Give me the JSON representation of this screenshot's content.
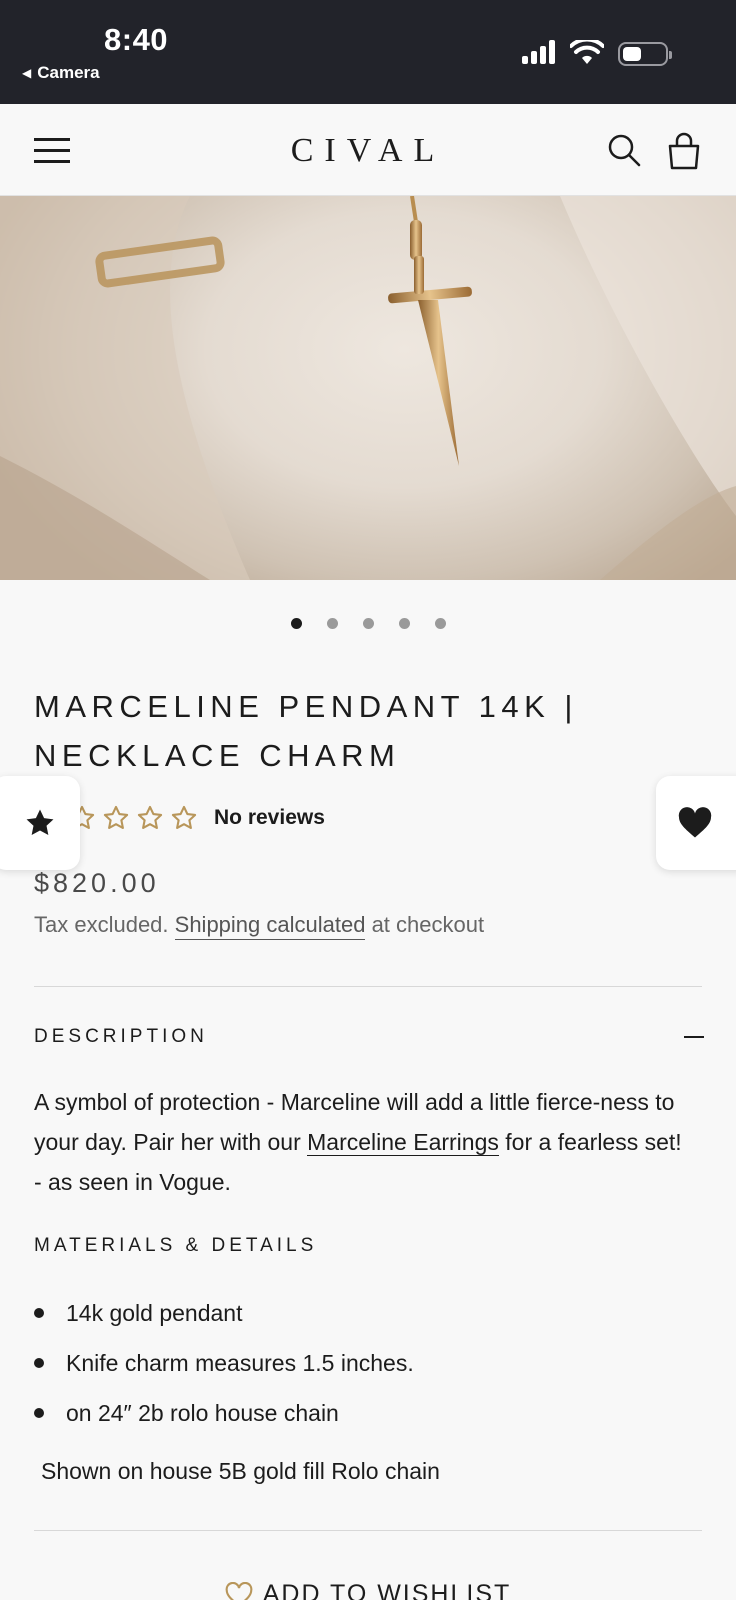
{
  "status_bar": {
    "time": "8:40",
    "back_label": "Camera",
    "icons": [
      "signal-icon",
      "wifi-icon",
      "battery-icon"
    ]
  },
  "header": {
    "logo": "CIVAL",
    "icons": [
      "hamburger-menu-icon",
      "search-icon",
      "shopping-bag-icon"
    ]
  },
  "carousel": {
    "slide_count": 5,
    "active_index": 0
  },
  "product": {
    "title_line1": "MARCELINE PENDANT 14K |",
    "title_line2": "NECKLACE CHARM",
    "rating": {
      "stars": 5,
      "filled": 0,
      "reviews_label": "No reviews"
    },
    "price": "$820.00",
    "tax_prefix": "Tax excluded. ",
    "shipping_link": "Shipping calculated",
    "tax_suffix": " at checkout"
  },
  "description": {
    "heading": "DESCRIPTION",
    "text_before": "A symbol of protection - Marceline will add a little fierce-ness to your day. Pair her with our ",
    "link": "Marceline Earrings",
    "text_after": " for a fearless set! - as seen in Vogue."
  },
  "materials": {
    "heading": "MATERIALS & DETAILS",
    "items": [
      "14k gold pendant",
      "Knife charm measures 1.5 inches.",
      "on 24″ 2b rolo house chain"
    ],
    "note": "Shown on house 5B gold fill Rolo chain"
  },
  "wishlist": {
    "label": "ADD TO WISHLIST"
  },
  "colors": {
    "accent_gold": "#b8965a",
    "status_bar_bg": "#22232a",
    "page_bg": "#f8f8f8"
  }
}
